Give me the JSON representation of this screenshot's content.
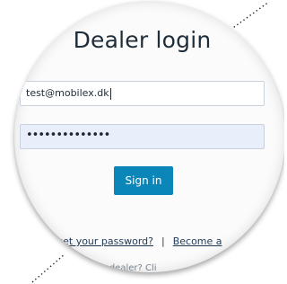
{
  "title": "Dealer login",
  "email": {
    "value": "test@mobilex.dk"
  },
  "password": {
    "masked": "••••••••••••••"
  },
  "signin": {
    "label": "Sign in"
  },
  "links": {
    "forgot": "ou forget your password?",
    "separator": "|",
    "become": "Become a"
  },
  "dealer_prompt": "as a dealer? Cli",
  "colors": {
    "accent": "#0a86b8",
    "password_field_bg": "#e8effb"
  }
}
